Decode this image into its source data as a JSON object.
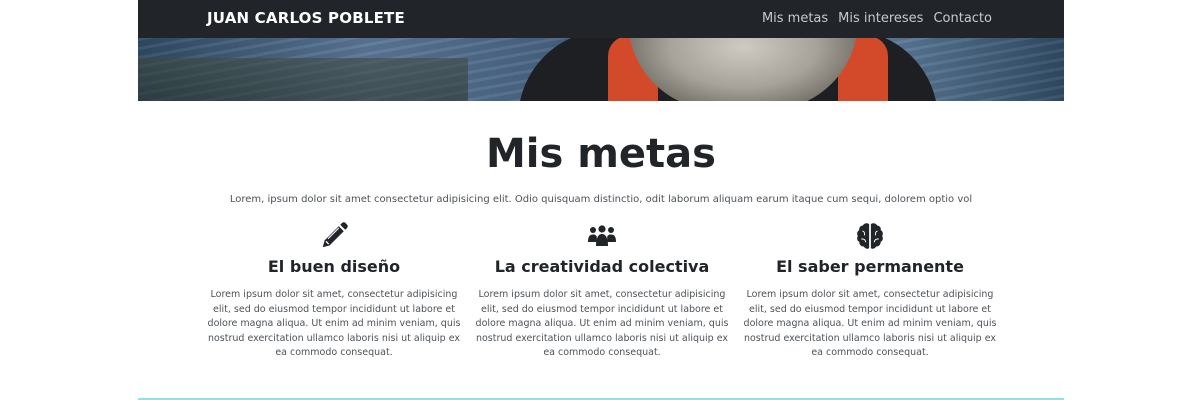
{
  "navbar": {
    "brand": "JUAN CARLOS POBLETE",
    "links": [
      {
        "label": "Mis metas"
      },
      {
        "label": "Mis intereses"
      },
      {
        "label": "Contacto"
      }
    ]
  },
  "hero": {
    "image_icon": "portrait-photo"
  },
  "metas": {
    "title": "Mis metas",
    "lead": "Lorem, ipsum dolor sit amet consectetur adipisicing elit. Odio quisquam distinctio, odit laborum aliquam earum itaque cum sequi, dolorem optio vol",
    "features": [
      {
        "icon": "pencil-icon",
        "title": "El buen diseño",
        "text": "Lorem ipsum dolor sit amet, consectetur adipisicing elit, sed do eiusmod tempor incididunt ut labore et dolore magna aliqua. Ut enim ad minim veniam, quis nostrud exercitation ullamco laboris nisi ut aliquip ex ea commodo consequat."
      },
      {
        "icon": "people-group-icon",
        "title": "La creatividad colectiva",
        "text": "Lorem ipsum dolor sit amet, consectetur adipisicing elit, sed do eiusmod tempor incididunt ut labore et dolore magna aliqua. Ut enim ad minim veniam, quis nostrud exercitation ullamco laboris nisi ut aliquip ex ea commodo consequat."
      },
      {
        "icon": "brain-icon",
        "title": "El saber permanente",
        "text": "Lorem ipsum dolor sit amet, consectetur adipisicing elit, sed do eiusmod tempor incididunt ut labore et dolore magna aliqua. Ut enim ad minim veniam, quis nostrud exercitation ullamco laboris nisi ut aliquip ex ea commodo consequat."
      }
    ]
  },
  "colors": {
    "navbar_bg": "#212529",
    "divider": "#8fe1e8",
    "text": "#212529"
  }
}
